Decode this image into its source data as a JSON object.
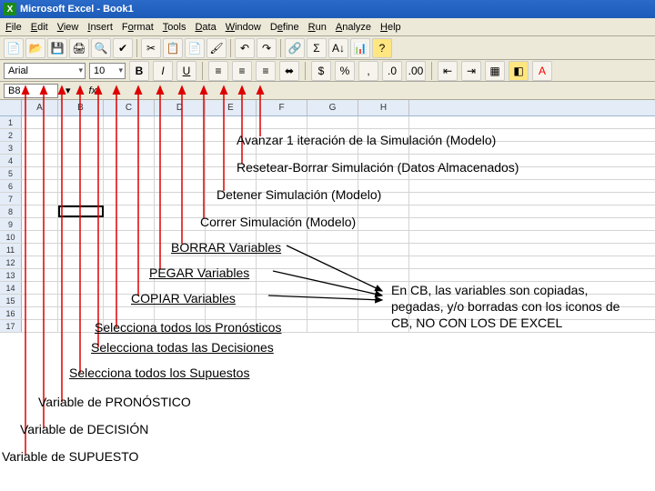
{
  "title": "Microsoft Excel - Book1",
  "menu": {
    "file": "File",
    "edit": "Edit",
    "view": "View",
    "insert": "Insert",
    "format": "Format",
    "tools": "Tools",
    "data": "Data",
    "window": "Window",
    "run": "Run",
    "analyze": "Analyze",
    "help": "Help"
  },
  "font": {
    "name": "Arial",
    "size": "10",
    "bold": "B",
    "italic": "I",
    "underline": "U"
  },
  "namebox": "B8",
  "fx": "fx",
  "cols": [
    "A",
    "B",
    "C",
    "D",
    "E",
    "F",
    "G",
    "H"
  ],
  "rows": [
    "1",
    "2",
    "3",
    "4",
    "5",
    "6",
    "7",
    "8",
    "9",
    "10",
    "11",
    "12",
    "13",
    "14",
    "15",
    "16",
    "17"
  ],
  "labels": {
    "avanzar": "Avanzar 1 iteración de la Simulación (Modelo)",
    "resetear": "Resetear-Borrar Simulación (Datos Almacenados)",
    "detener": "Detener Simulación (Modelo)",
    "correr": "Correr Simulación (Modelo)",
    "borrar": "BORRAR Variables",
    "pegar": "PEGAR Variables",
    "copiar": "COPIAR Variables",
    "sel_pron": "Selecciona todos los Pronósticos",
    "sel_dec": "Selecciona todas las Decisiones",
    "sel_sup": "Selecciona todos los Supuestos",
    "var_pron": "Variable de PRONÓSTICO",
    "var_dec": "Variable de DECISIÓN",
    "var_sup": "Variable de SUPUESTO"
  },
  "note": "En CB, las variables son copiadas, pegadas, y/o borradas con los iconos de CB, NO CON LOS DE EXCEL",
  "icons": {
    "new": "📄",
    "open": "📂",
    "save": "💾",
    "print": "🖨",
    "cut": "✂",
    "copy": "📋",
    "paste": "📄",
    "undo": "↶",
    "redo": "↷",
    "sort": "A↓",
    "chart": "📊",
    "sum": "Σ"
  }
}
